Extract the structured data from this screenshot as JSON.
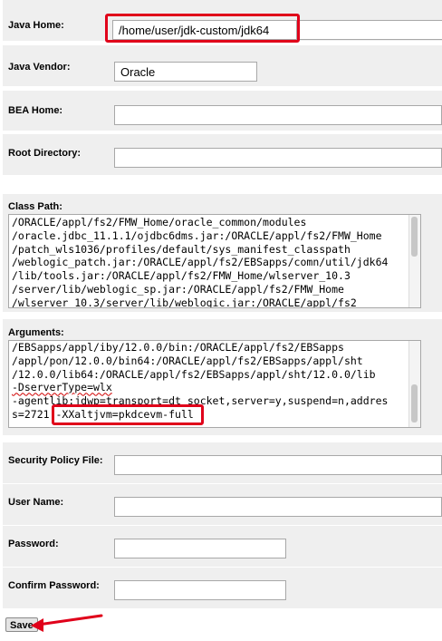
{
  "form": {
    "java_home": {
      "label": "Java Home:",
      "value": "/home/user/jdk-custom/jdk64"
    },
    "java_vendor": {
      "label": "Java Vendor:",
      "value": "Oracle"
    },
    "bea_home": {
      "label": "BEA Home:",
      "value": ""
    },
    "root_directory": {
      "label": "Root Directory:",
      "value": ""
    },
    "class_path": {
      "label": "Class Path:",
      "lines": [
        "/ORACLE/appl/fs2/FMW_Home/oracle_common/modules",
        "/oracle.jdbc_11.1.1/ojdbc6dms.jar:/ORACLE/appl/fs2/FMW_Home",
        "/patch_wls1036/profiles/default/sys_manifest_classpath",
        "/weblogic_patch.jar:/ORACLE/appl/fs2/EBSapps/comn/util/jdk64",
        "/lib/tools.jar:/ORACLE/appl/fs2/FMW_Home/wlserver_10.3",
        "/server/lib/weblogic_sp.jar:/ORACLE/appl/fs2/FMW_Home",
        "/wlserver_10.3/server/lib/weblogic.jar:/ORACLE/appl/fs2"
      ]
    },
    "arguments": {
      "label": "Arguments:",
      "lines": [
        "/EBSapps/appl/iby/12.0.0/bin:/ORACLE/appl/fs2/EBSapps",
        "/appl/pon/12.0.0/bin64:/ORACLE/appl/fs2/EBSapps/appl/sht",
        "/12.0.0/lib64:/ORACLE/appl/fs2/EBSapps/appl/sht/12.0.0/lib",
        "-DserverType=wlx",
        "-agentlib:jdwp=transport=dt_socket,server=y,suspend=n,addres"
      ],
      "last_line_prefix": "s=2721 ",
      "last_line_highlight": "-XXaltjvm=pkdcevm-full"
    },
    "security_policy_file": {
      "label": "Security Policy File:",
      "value": ""
    },
    "user_name": {
      "label": "User Name:",
      "value": ""
    },
    "password": {
      "label": "Password:",
      "value": ""
    },
    "confirm_password": {
      "label": "Confirm Password:",
      "value": ""
    },
    "save_label": "Save"
  },
  "colors": {
    "highlight": "#e0001a",
    "row_background": "#efefef"
  }
}
